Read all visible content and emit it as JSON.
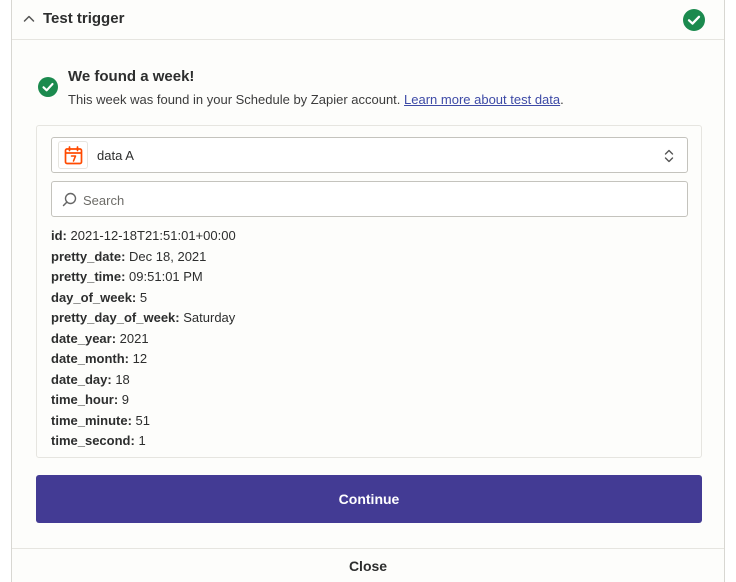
{
  "header": {
    "title": "Test trigger",
    "collapse_icon": "chevron-up-icon",
    "status_icon": "check-circle-icon"
  },
  "result": {
    "title": "We found a week!",
    "description": "This week was found in your Schedule by Zapier account.",
    "link_text": "Learn more about test data",
    "trailing": "."
  },
  "selector": {
    "app_icon": "calendar-icon",
    "value": "data A",
    "arrow_icon": "sort-arrows-icon"
  },
  "search": {
    "placeholder": "Search",
    "value": ""
  },
  "fields": [
    {
      "key": "id:",
      "value": "2021-12-18T21:51:01+00:00"
    },
    {
      "key": "pretty_date:",
      "value": "Dec 18, 2021"
    },
    {
      "key": "pretty_time:",
      "value": "09:51:01 PM"
    },
    {
      "key": "day_of_week:",
      "value": "5"
    },
    {
      "key": "pretty_day_of_week:",
      "value": "Saturday"
    },
    {
      "key": "date_year:",
      "value": "2021"
    },
    {
      "key": "date_month:",
      "value": "12"
    },
    {
      "key": "date_day:",
      "value": "18"
    },
    {
      "key": "time_hour:",
      "value": "9"
    },
    {
      "key": "time_minute:",
      "value": "51"
    },
    {
      "key": "time_second:",
      "value": "1"
    }
  ],
  "actions": {
    "continue_label": "Continue",
    "close_label": "Close"
  },
  "colors": {
    "success": "#1b8a4e",
    "primary": "#433b94",
    "link": "#3d4aa6",
    "calendar": "#ff4a00"
  }
}
